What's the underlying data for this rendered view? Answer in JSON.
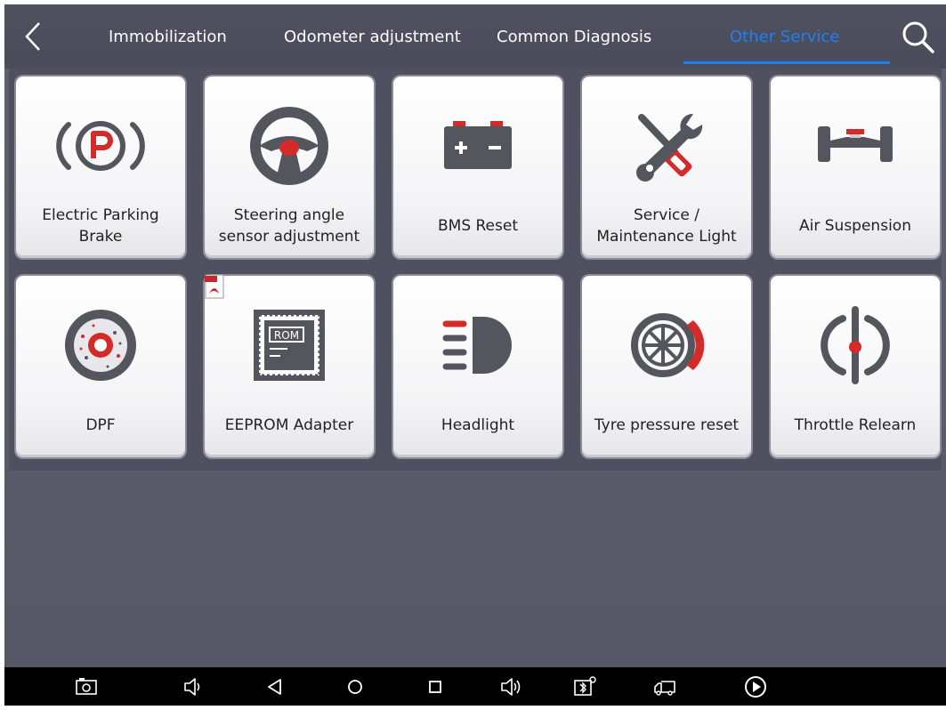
{
  "header": {
    "back_icon": "chevron-left-icon",
    "tabs": [
      {
        "label": "Immobilization"
      },
      {
        "label": "Odometer adjustment"
      },
      {
        "label": "Common Diagnosis"
      },
      {
        "label": "Other Service"
      }
    ],
    "active_tab": "Other Service",
    "search_icon": "search-icon"
  },
  "functions": [
    {
      "label": "Electric Parking Brake",
      "icon": "parking-brake-icon"
    },
    {
      "label": "Steering angle sensor adjustment",
      "icon": "steering-wheel-icon"
    },
    {
      "label": "BMS Reset",
      "icon": "battery-icon"
    },
    {
      "label": "Service / Maintenance Light",
      "icon": "wrench-screwdriver-icon"
    },
    {
      "label": "Air Suspension",
      "icon": "axle-icon"
    },
    {
      "label": "DPF",
      "icon": "particulate-filter-icon"
    },
    {
      "label": "EEPROM Adapter",
      "icon": "rom-chip-icon",
      "badge": "pdf-icon"
    },
    {
      "label": "Headlight",
      "icon": "headlight-icon"
    },
    {
      "label": "Tyre pressure reset",
      "icon": "tyre-brake-icon"
    },
    {
      "label": "Throttle Relearn",
      "icon": "throttle-icon"
    }
  ],
  "nav_bar": {
    "icons": [
      "screenshot-icon",
      "volume-down-icon",
      "back-triangle-icon",
      "home-circle-icon",
      "recents-square-icon",
      "volume-up-icon",
      "vci-bluetooth-icon",
      "truck-icon",
      "play-icon"
    ]
  },
  "colors": {
    "accent": "#1e7ff0",
    "icon_gray": "#54565e",
    "icon_red": "#d42a2a"
  }
}
